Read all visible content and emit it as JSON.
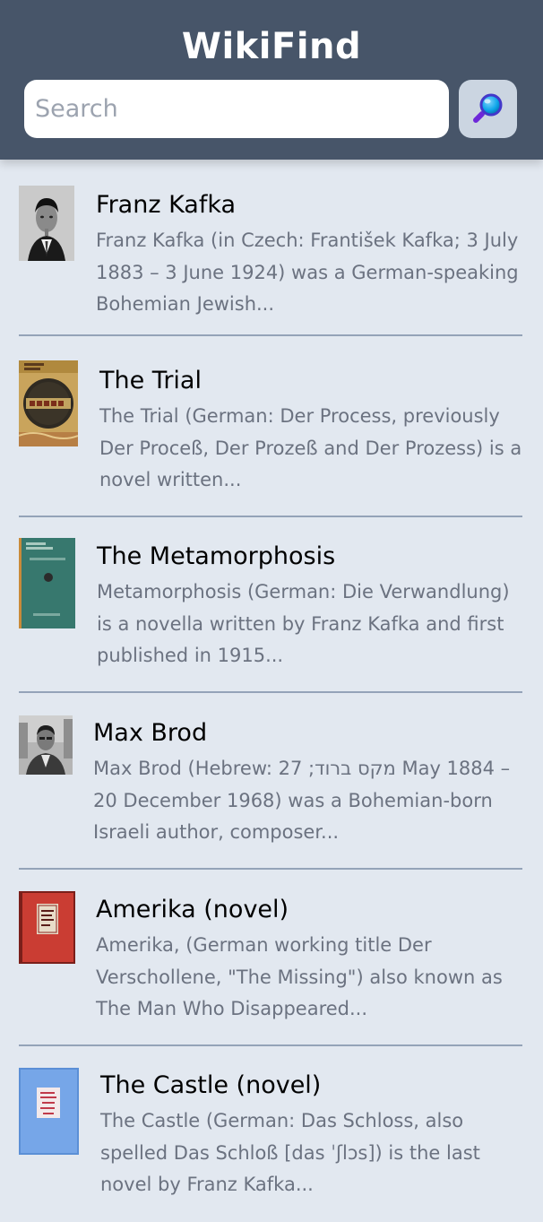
{
  "header": {
    "title": "WikiFind",
    "search_placeholder": "Search",
    "search_value": "",
    "search_button_icon": "magnifying-glass-icon",
    "background": "#475569"
  },
  "results": [
    {
      "title": "Franz Kafka",
      "snippet": "Franz Kafka (in Czech: František Kafka; 3 July 1883 – 3 June 1924) was a German-speaking Bohemian Jewish...",
      "thumbnail": "portrait-photo-thumbnail"
    },
    {
      "title": "The Trial",
      "snippet": "The Trial (German: Der Process, previously Der Proceß, Der Prozeß and Der Prozess) is a novel written...",
      "thumbnail": "book-cover-thumbnail"
    },
    {
      "title": "The Metamorphosis",
      "snippet": "Metamorphosis (German: Die Verwandlung) is a novella written by Franz Kafka and first published in 1915...",
      "thumbnail": "book-cover-thumbnail"
    },
    {
      "title": "Max Brod",
      "snippet": "Max Brod (Hebrew: מקס ברוד; 27 May 1884 – 20 December 1968) was a Bohemian-born Israeli author, composer...",
      "thumbnail": "portrait-photo-thumbnail"
    },
    {
      "title": "Amerika (novel)",
      "snippet": "Amerika, (German working title Der Verschollene, \"The Missing\") also known as The Man Who Disappeared...",
      "thumbnail": "book-cover-thumbnail"
    },
    {
      "title": "The Castle (novel)",
      "snippet": "The Castle (German: Das Schloss, also spelled Das Schloß [das ˈʃlɔs]) is the last novel by Franz Kafka...",
      "thumbnail": "book-cover-thumbnail"
    }
  ]
}
